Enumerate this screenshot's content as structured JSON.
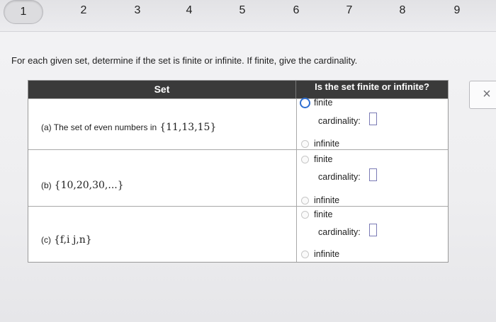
{
  "nav": {
    "questions": [
      "1",
      "2",
      "3",
      "4",
      "5",
      "6",
      "7",
      "8",
      "9"
    ],
    "active": "1"
  },
  "instruction": "For each given set, determine if the set is finite or infinite. If finite, give the cardinality.",
  "table": {
    "header_set": "Set",
    "header_choice": "Is the set finite or infinite?",
    "rows": [
      {
        "label": "(a)  The set of even numbers in",
        "math": "{11,13,15}",
        "finite": "finite",
        "cardinality": "cardinality:",
        "infinite": "infinite",
        "selected": "finite"
      },
      {
        "label": "(b)",
        "math": "{10,20,30,...}",
        "finite": "finite",
        "cardinality": "cardinality:",
        "infinite": "infinite",
        "selected": ""
      },
      {
        "label": "(c)",
        "math": "{f,i j,n}",
        "finite": "finite",
        "cardinality": "cardinality:",
        "infinite": "infinite",
        "selected": ""
      }
    ]
  },
  "close_symbol": "×",
  "colors": {
    "header": "#3a3a3a",
    "selected_radio": "#2f6fd1"
  }
}
